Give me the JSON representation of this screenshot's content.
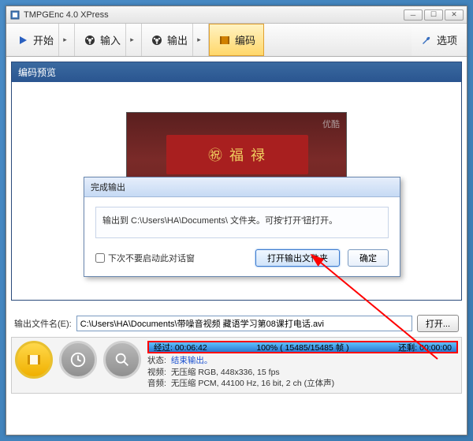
{
  "window": {
    "title": "TMPGEnc 4.0 XPress"
  },
  "toolbar": {
    "start": "开始",
    "input": "输入",
    "output": "输出",
    "encode": "编码",
    "options": "选项"
  },
  "preview": {
    "header": "编码预览",
    "watermark": "优酷"
  },
  "dialog": {
    "title": "完成输出",
    "message": "输出到 C:\\Users\\HA\\Documents\\ 文件夹。可按'打开'钮打开。",
    "checkbox_label": "下次不要启动此对话窗",
    "open_btn": "打开输出文件夹",
    "ok_btn": "确定"
  },
  "output": {
    "label": "输出文件名(E):",
    "path": "C:\\Users\\HA\\Documents\\带噪音视频 藏语学习第08课打电话.avi",
    "open_btn": "打开..."
  },
  "progress": {
    "elapsed_label": "经过:",
    "elapsed": "00:06:42",
    "percent": "100% ( 15485/15485 帧 )",
    "remain_label": "还剩:",
    "remain": "00:00:00"
  },
  "status": {
    "state_label": "状态:",
    "state_value": "结束输出。",
    "video_label": "视频:",
    "video_value": "无压缩 RGB, 448x336, 15 fps",
    "audio_label": "音频:",
    "audio_value": "无压缩 PCM, 44100 Hz, 16 bit, 2 ch (立体声)"
  }
}
